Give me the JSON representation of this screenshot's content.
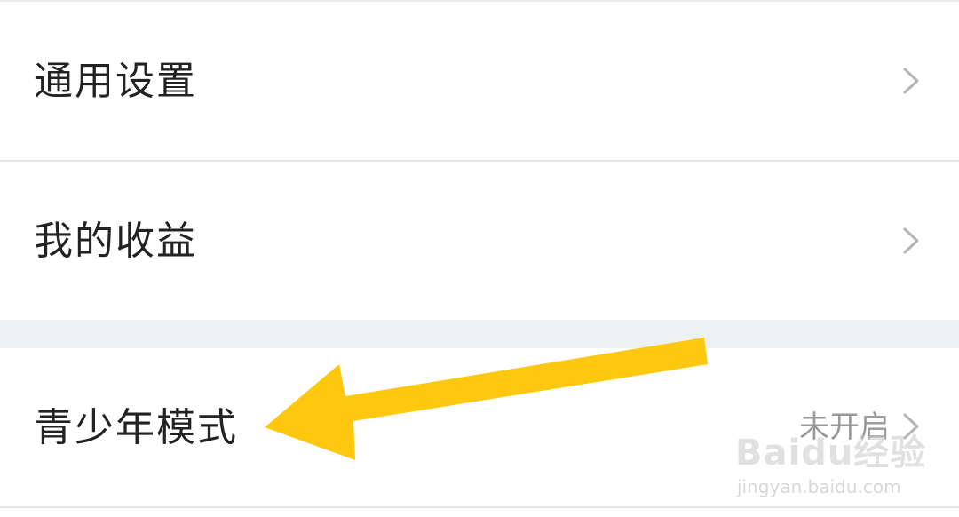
{
  "settings": {
    "items": [
      {
        "label": "通用设置"
      },
      {
        "label": "我的收益"
      },
      {
        "label": "青少年模式",
        "value": "未开启"
      }
    ]
  },
  "icons": {
    "chevron": "chevron-right-icon",
    "annotation": "arrow-annotation"
  },
  "colors": {
    "arrow": "#FDC80E",
    "section_gap": "#EEF1F4",
    "text": "#222222",
    "secondary_text": "#999999"
  },
  "watermark": {
    "logo_text": "Baidu经验",
    "url": "jingyan.baidu.com"
  }
}
